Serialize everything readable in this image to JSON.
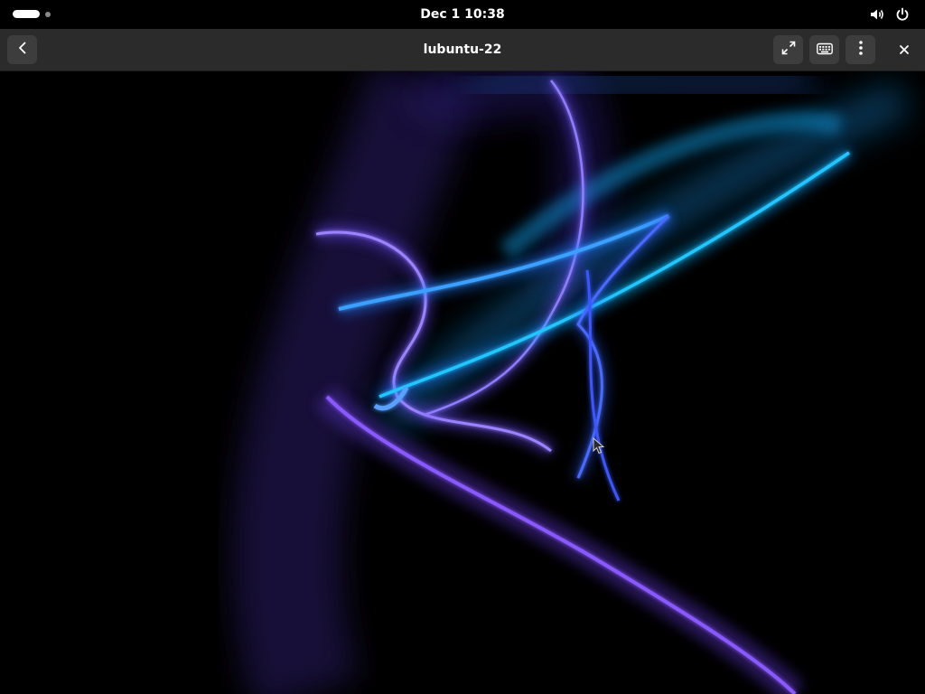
{
  "topbar": {
    "clock": "Dec 1  10:38",
    "icons": {
      "activities": "workspace-indicator",
      "volume": "volume-icon",
      "power": "power-icon"
    }
  },
  "window": {
    "title": "lubuntu-22",
    "buttons": {
      "back": "back-arrow-icon",
      "fullscreen": "fullscreen-icon",
      "keyboard": "keyboard-icon",
      "menu": "kebab-menu-icon",
      "close": "close-icon"
    }
  },
  "content": {
    "type": "remote-desktop-view",
    "background": "#000000",
    "accent_colors": [
      "#2a6bff",
      "#00c8ff",
      "#7a4dff",
      "#9a5cff"
    ]
  }
}
